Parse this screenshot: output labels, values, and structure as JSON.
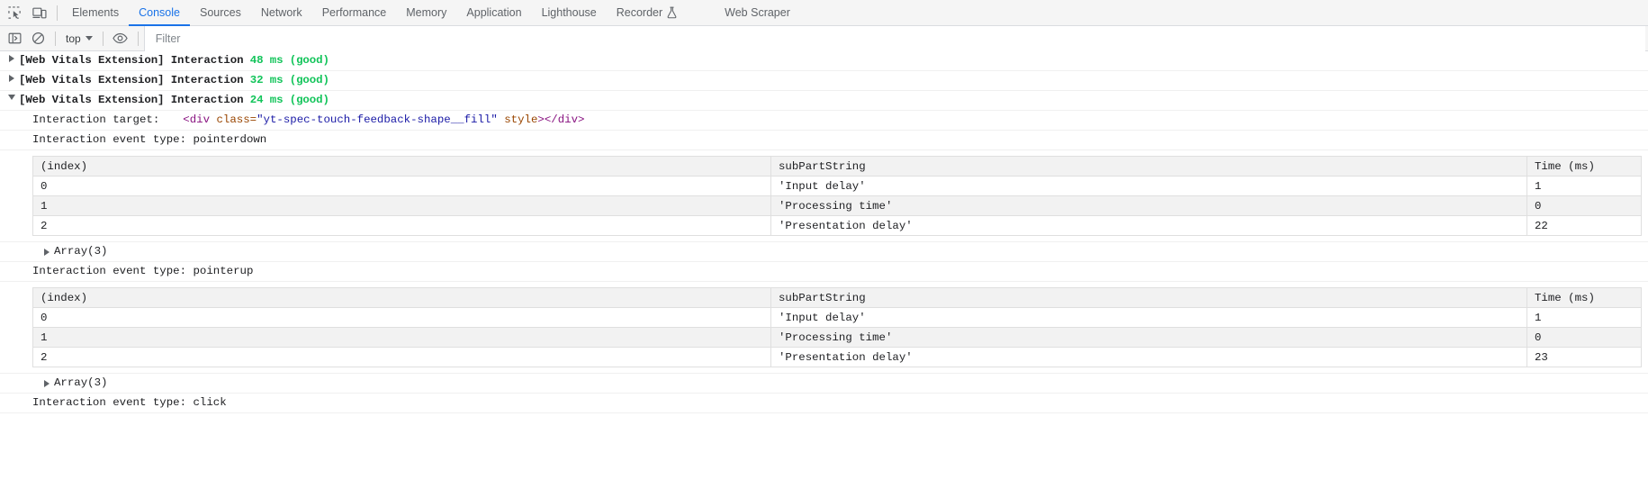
{
  "devtools": {
    "toolbar_icons": [
      {
        "name": "inspect-element-icon",
        "title": "Inspect element"
      },
      {
        "name": "device-toolbar-icon",
        "title": "Toggle device toolbar"
      }
    ],
    "tabs": [
      {
        "label": "Elements",
        "active": false,
        "experimental": false
      },
      {
        "label": "Console",
        "active": true,
        "experimental": false
      },
      {
        "label": "Sources",
        "active": false,
        "experimental": false
      },
      {
        "label": "Network",
        "active": false,
        "experimental": false
      },
      {
        "label": "Performance",
        "active": false,
        "experimental": false
      },
      {
        "label": "Memory",
        "active": false,
        "experimental": false
      },
      {
        "label": "Application",
        "active": false,
        "experimental": false
      },
      {
        "label": "Lighthouse",
        "active": false,
        "experimental": false
      },
      {
        "label": "Recorder",
        "active": false,
        "experimental": true
      },
      {
        "label": "Web Scraper",
        "active": false,
        "experimental": false
      }
    ]
  },
  "console_toolbar": {
    "sidebar_toggle": "sidebar-toggle-icon",
    "clear_console": "clear-console-icon",
    "context_label": "top",
    "live_expressions": "eye-icon",
    "filter_placeholder": "Filter",
    "filter_value": ""
  },
  "console_messages": [
    {
      "expanded": false,
      "prefix": "[Web Vitals Extension] Interaction ",
      "metric": "48 ms (good)"
    },
    {
      "expanded": false,
      "prefix": "[Web Vitals Extension] Interaction ",
      "metric": "32 ms (good)"
    },
    {
      "expanded": true,
      "prefix": "[Web Vitals Extension] Interaction ",
      "metric": "24 ms (good)"
    }
  ],
  "interaction_detail": {
    "target_label": "Interaction target:",
    "target_snippet": {
      "open": "<div ",
      "attr_name": "class=",
      "attr_value": "\"yt-spec-touch-feedback-shape__fill\"",
      "attr2": " style",
      "close_bracket": ">",
      "close_tag": "</div>"
    },
    "events": [
      {
        "event_label": "Interaction event type: pointerdown",
        "table": {
          "headers": [
            "(index)",
            "subPartString",
            "Time (ms)"
          ],
          "rows": [
            {
              "index": "0",
              "subPartString": "'Input delay'",
              "time": "1"
            },
            {
              "index": "1",
              "subPartString": "'Processing time'",
              "time": "0"
            },
            {
              "index": "2",
              "subPartString": "'Presentation delay'",
              "time": "22"
            }
          ]
        },
        "array_label": "Array(3)"
      },
      {
        "event_label": "Interaction event type: pointerup",
        "table": {
          "headers": [
            "(index)",
            "subPartString",
            "Time (ms)"
          ],
          "rows": [
            {
              "index": "0",
              "subPartString": "'Input delay'",
              "time": "1"
            },
            {
              "index": "1",
              "subPartString": "'Processing time'",
              "time": "0"
            },
            {
              "index": "2",
              "subPartString": "'Presentation delay'",
              "time": "23"
            }
          ]
        },
        "array_label": "Array(3)"
      },
      {
        "event_label": "Interaction event type: click",
        "table": null,
        "array_label": null
      }
    ]
  },
  "colors": {
    "accent": "#1a73e8",
    "good": "#12c45a",
    "string": "#c41a16",
    "number": "#1a1aa6",
    "tag": "#881280",
    "attr": "#994500"
  }
}
